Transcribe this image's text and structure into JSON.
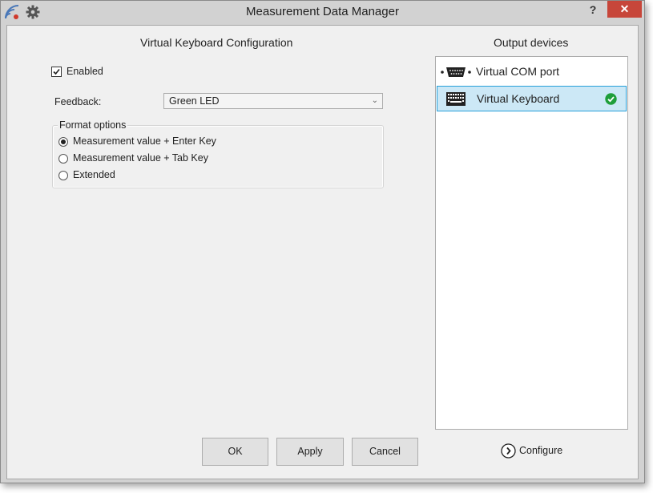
{
  "window": {
    "title": "Measurement Data Manager",
    "help_label": "?",
    "close_label": "✕",
    "accent_close": "#c7463a"
  },
  "config": {
    "title": "Virtual Keyboard Configuration",
    "enabled_label": "Enabled",
    "enabled_checked": true,
    "feedback_label": "Feedback:",
    "feedback_value": "Green LED",
    "format_group_label": "Format options",
    "format_options": [
      {
        "label": "Measurement value + Enter Key",
        "selected": true
      },
      {
        "label": "Measurement value + Tab Key",
        "selected": false
      },
      {
        "label": "Extended",
        "selected": false
      }
    ]
  },
  "devices": {
    "title": "Output devices",
    "items": [
      {
        "label": "Virtual COM port",
        "icon": "serial-port-icon",
        "selected": false
      },
      {
        "label": "Virtual Keyboard",
        "icon": "keyboard-icon",
        "selected": true,
        "active": true
      }
    ],
    "configure_label": "Configure"
  },
  "buttons": {
    "ok": "OK",
    "apply": "Apply",
    "cancel": "Cancel"
  },
  "colors": {
    "selection_bg": "#cce8f6",
    "selection_border": "#26a0da",
    "check_green": "#1e9e3a"
  }
}
